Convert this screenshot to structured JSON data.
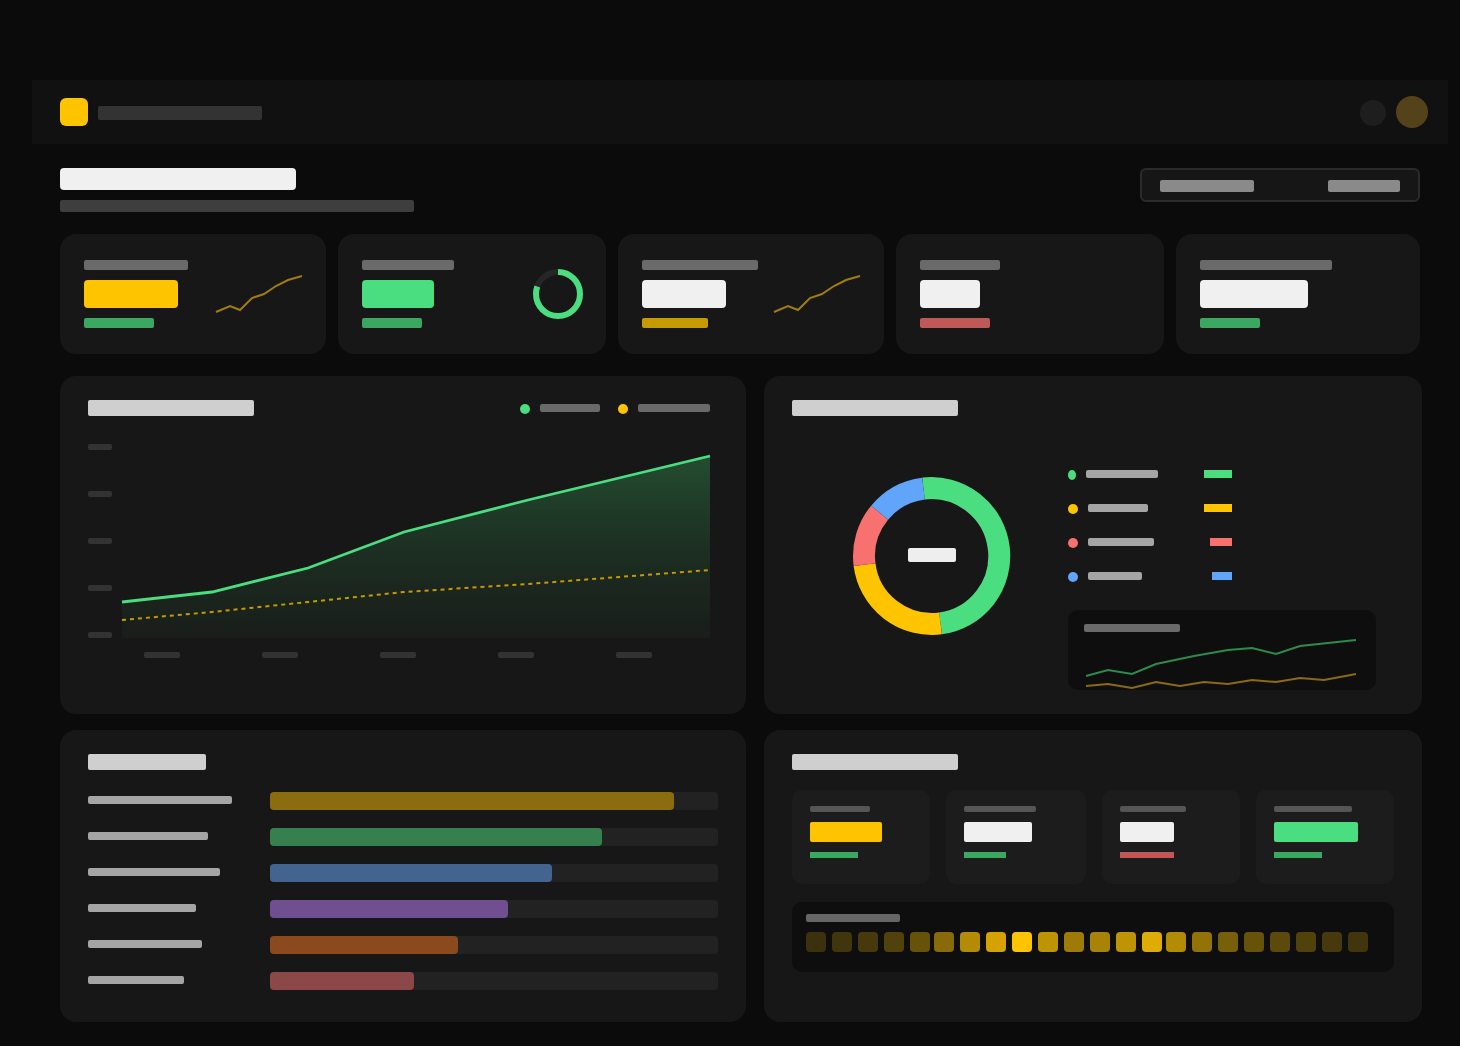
{
  "kpis": [
    {
      "kind": "sparkline",
      "value": {
        "color": "#ffc400"
      },
      "delta": {
        "color": "#3aa860"
      }
    },
    {
      "kind": "ring",
      "value": {
        "color": "#4ade80"
      },
      "delta": {
        "color": "#3aa860"
      },
      "level": 0.8
    },
    {
      "kind": "sparkline",
      "value": {
        "color": "#f0f0f0"
      },
      "delta": {
        "color": "#c69a00"
      }
    },
    {
      "kind": "none",
      "value": {
        "color": "#f0f0f0"
      },
      "delta": {
        "color": "#c05858"
      }
    },
    {
      "kind": "none",
      "value": {
        "color": "#f0f0f0"
      },
      "delta": {
        "color": "#3aa860"
      }
    }
  ],
  "legend": [
    {
      "color": "#4ade80"
    },
    {
      "color": "#ffc400"
    }
  ],
  "donut": [
    {
      "color": "#4ade80"
    },
    {
      "color": "#ffc400"
    },
    {
      "color": "#f87171"
    },
    {
      "color": "#60a5fa"
    }
  ],
  "bars": [
    {
      "color": "#8b6d10",
      "level": 0.9
    },
    {
      "color": "#36804f",
      "level": 0.74
    },
    {
      "color": "#43648e",
      "level": 0.63
    },
    {
      "color": "#6f4f8f",
      "level": 0.53
    },
    {
      "color": "#8b4a1d",
      "level": 0.42
    },
    {
      "color": "#8c4848",
      "level": 0.32
    }
  ],
  "stats": [
    {
      "value": {
        "color": "#ffc400"
      },
      "delta": {
        "color": "#3aa860"
      }
    },
    {
      "value": {
        "color": "#f0f0f0"
      },
      "delta": {
        "color": "#3aa860"
      }
    },
    {
      "value": {
        "color": "#f0f0f0"
      },
      "delta": {
        "color": "#c05858"
      }
    },
    {
      "value": {
        "color": "#4ade80"
      },
      "delta": {
        "color": "#3aa860"
      }
    }
  ]
}
